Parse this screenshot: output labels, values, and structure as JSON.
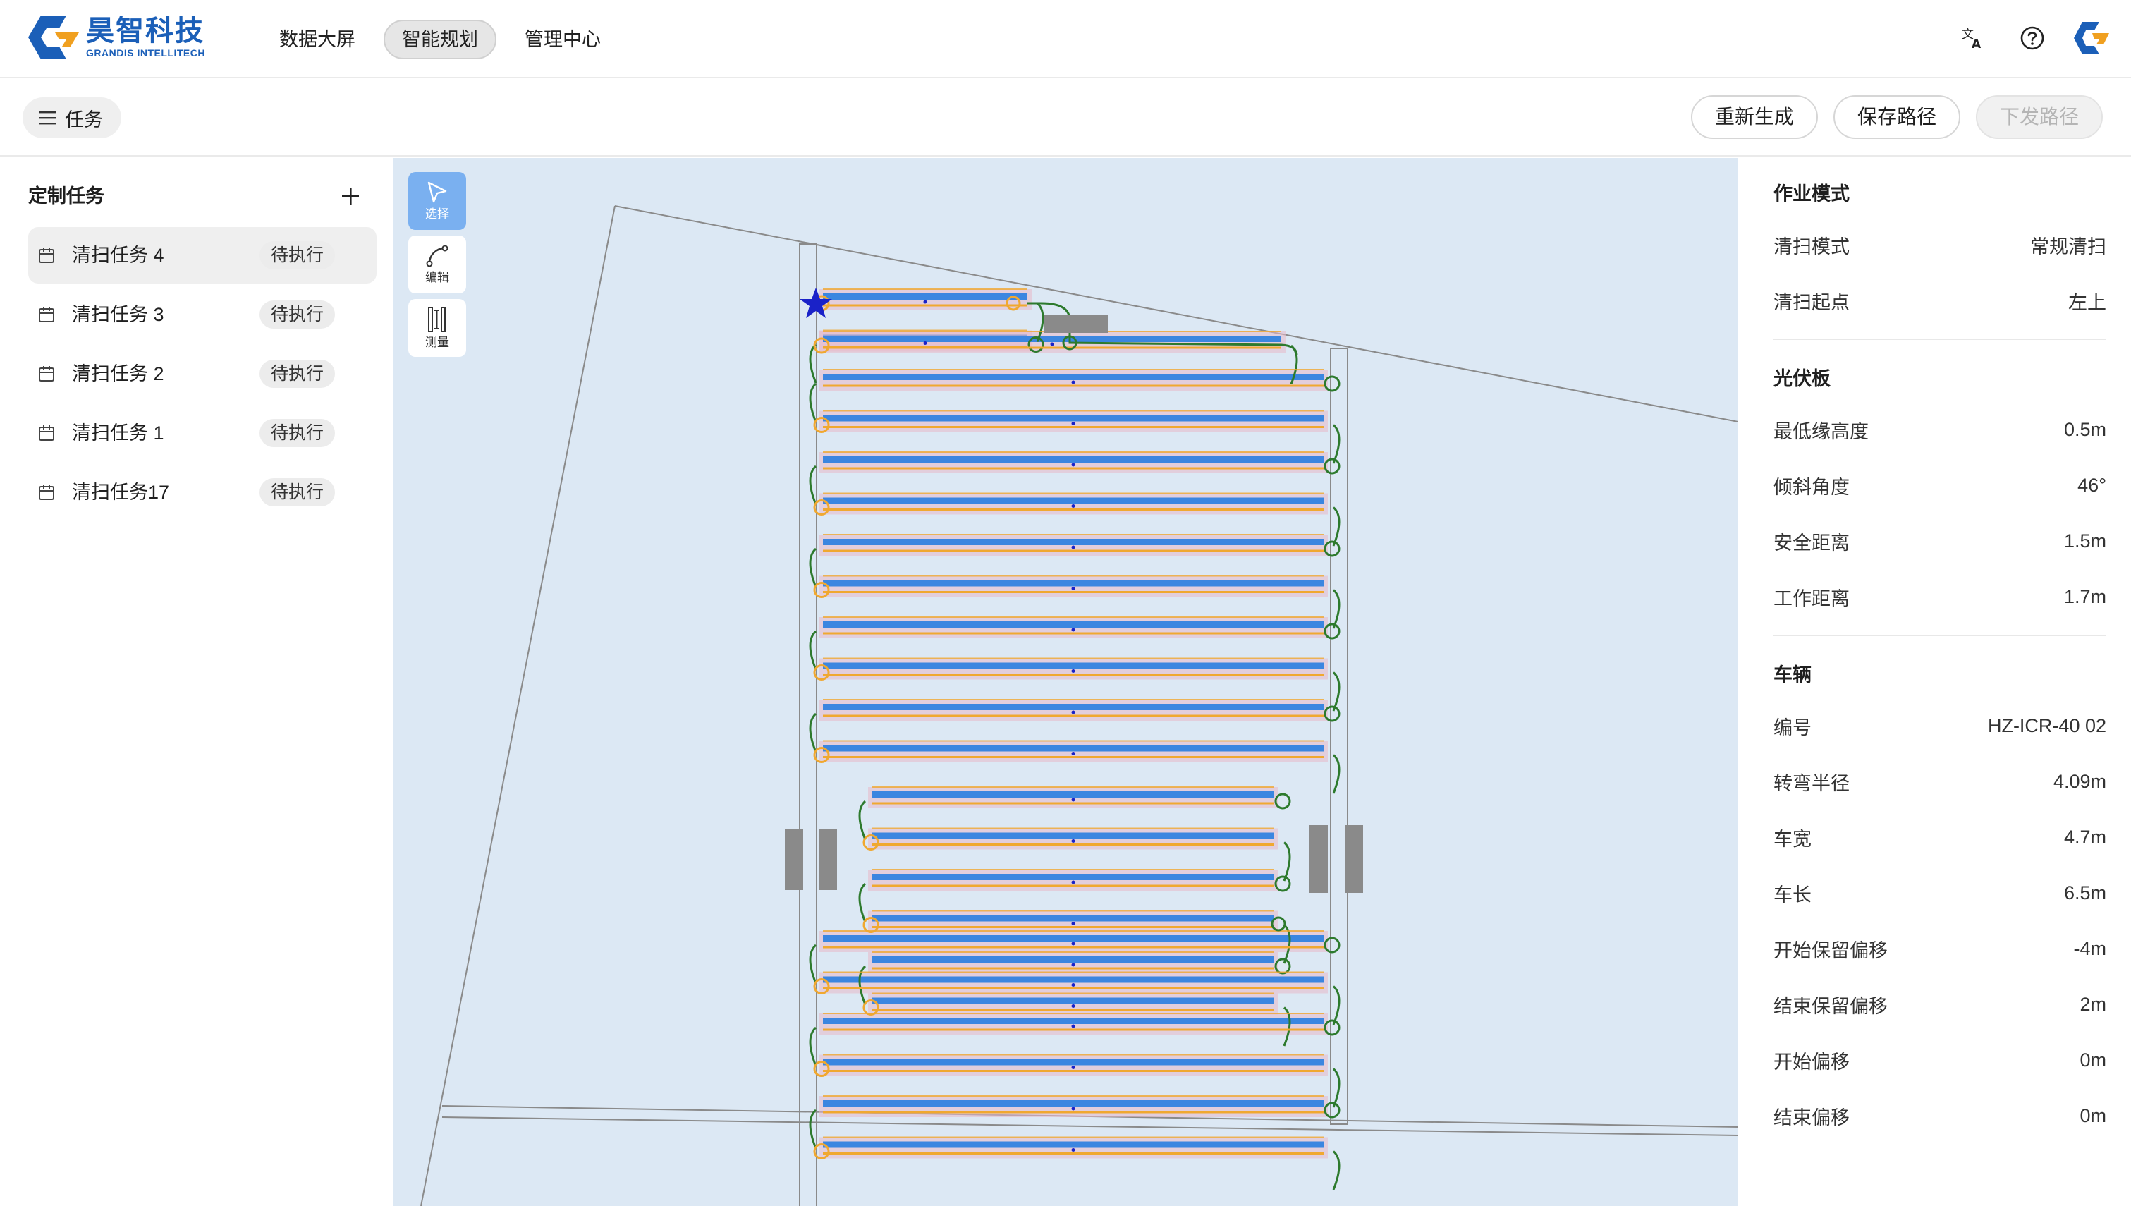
{
  "brand": {
    "name_cn": "昊智科技",
    "name_en": "GRANDIS INTELLITECH",
    "color_blue": "#1b5fb8",
    "color_orange": "#f0a020"
  },
  "nav": {
    "items": [
      {
        "label": "数据大屏"
      },
      {
        "label": "智能规划",
        "active": true
      },
      {
        "label": "管理中心"
      }
    ]
  },
  "top_icons": [
    "translate-icon",
    "help-icon",
    "user-avatar"
  ],
  "toolbar": {
    "task_toggle_label": "任务",
    "regenerate_label": "重新生成",
    "save_path_label": "保存路径",
    "dispatch_path_label": "下发路径"
  },
  "left_panel": {
    "title": "定制任务",
    "tasks": [
      {
        "name": "清扫任务 4",
        "status": "待执行",
        "selected": true
      },
      {
        "name": "清扫任务 3",
        "status": "待执行"
      },
      {
        "name": "清扫任务 2",
        "status": "待执行"
      },
      {
        "name": "清扫任务 1",
        "status": "待执行"
      },
      {
        "name": "清扫任务17",
        "status": "待执行"
      }
    ]
  },
  "map_tools": [
    {
      "label": "选择",
      "active": true
    },
    {
      "label": "编辑"
    },
    {
      "label": "测量"
    }
  ],
  "map_colors": {
    "background": "#dce8f4",
    "panel_row": "#3b86e0",
    "path_orange": "#f0a830",
    "path_green": "#2d7a2d",
    "path_pink": "#e8b8c8",
    "start_star": "#1a22c8",
    "obstacle": "#8a8a8a"
  },
  "right_panel": {
    "work_mode": {
      "title": "作业模式",
      "rows": [
        {
          "key": "清扫模式",
          "value": "常规清扫"
        },
        {
          "key": "清扫起点",
          "value": "左上"
        }
      ]
    },
    "pv_panel": {
      "title": "光伏板",
      "rows": [
        {
          "key": "最低缘高度",
          "value": "0.5m"
        },
        {
          "key": "倾斜角度",
          "value": "46°"
        },
        {
          "key": "安全距离",
          "value": "1.5m"
        },
        {
          "key": "工作距离",
          "value": "1.7m"
        }
      ]
    },
    "vehicle": {
      "title": "车辆",
      "rows": [
        {
          "key": "编号",
          "value": "HZ-ICR-40 02"
        },
        {
          "key": "转弯半径",
          "value": "4.09m"
        },
        {
          "key": "车宽",
          "value": "4.7m"
        },
        {
          "key": "车长",
          "value": "6.5m"
        },
        {
          "key": "开始保留偏移",
          "value": "-4m"
        },
        {
          "key": "结束保留偏移",
          "value": "2m"
        },
        {
          "key": "开始偏移",
          "value": "0m"
        },
        {
          "key": "结束偏移",
          "value": "0m"
        }
      ]
    }
  }
}
